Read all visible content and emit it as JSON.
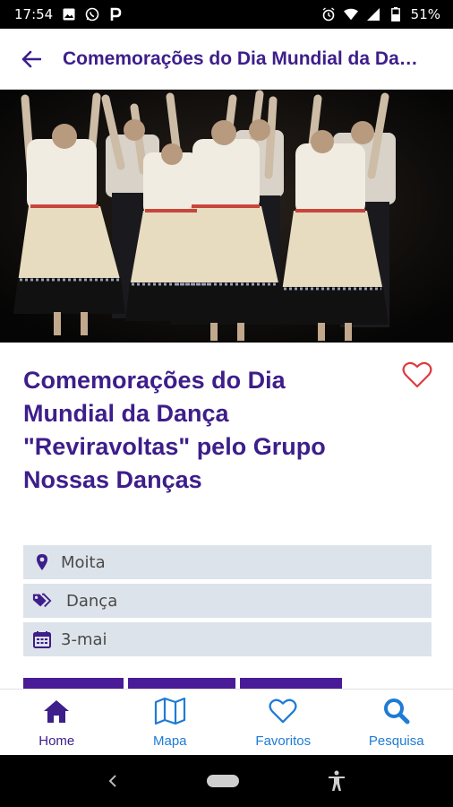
{
  "status_bar": {
    "time": "17:54",
    "battery": "51%",
    "left_icons": [
      "image-icon",
      "whatsapp-icon",
      "parking-icon"
    ],
    "right_icons": [
      "alarm-icon",
      "wifi-icon",
      "signal-icon",
      "battery-icon"
    ]
  },
  "app_bar": {
    "title": "Comemorações do Dia Mundial da Dança \"Reviravoltas\" pelo Grupo Nossas Danças",
    "back_icon": "arrow-left-icon"
  },
  "event": {
    "title": "Comemorações do Dia Mundial da Dança \"Reviravoltas\" pelo Grupo Nossas Danças",
    "favorite_icon": "heart-outline-icon",
    "location": "Moita",
    "category": "Dança",
    "date": "3-mai"
  },
  "bottom_nav": {
    "home": "Home",
    "map": "Mapa",
    "favorites": "Favoritos",
    "search": "Pesquisa"
  },
  "colors": {
    "primary": "#3d1e8a",
    "accent_blue": "#1f7bd6",
    "heart": "#e0393e",
    "info_bg": "#dde3ea"
  }
}
